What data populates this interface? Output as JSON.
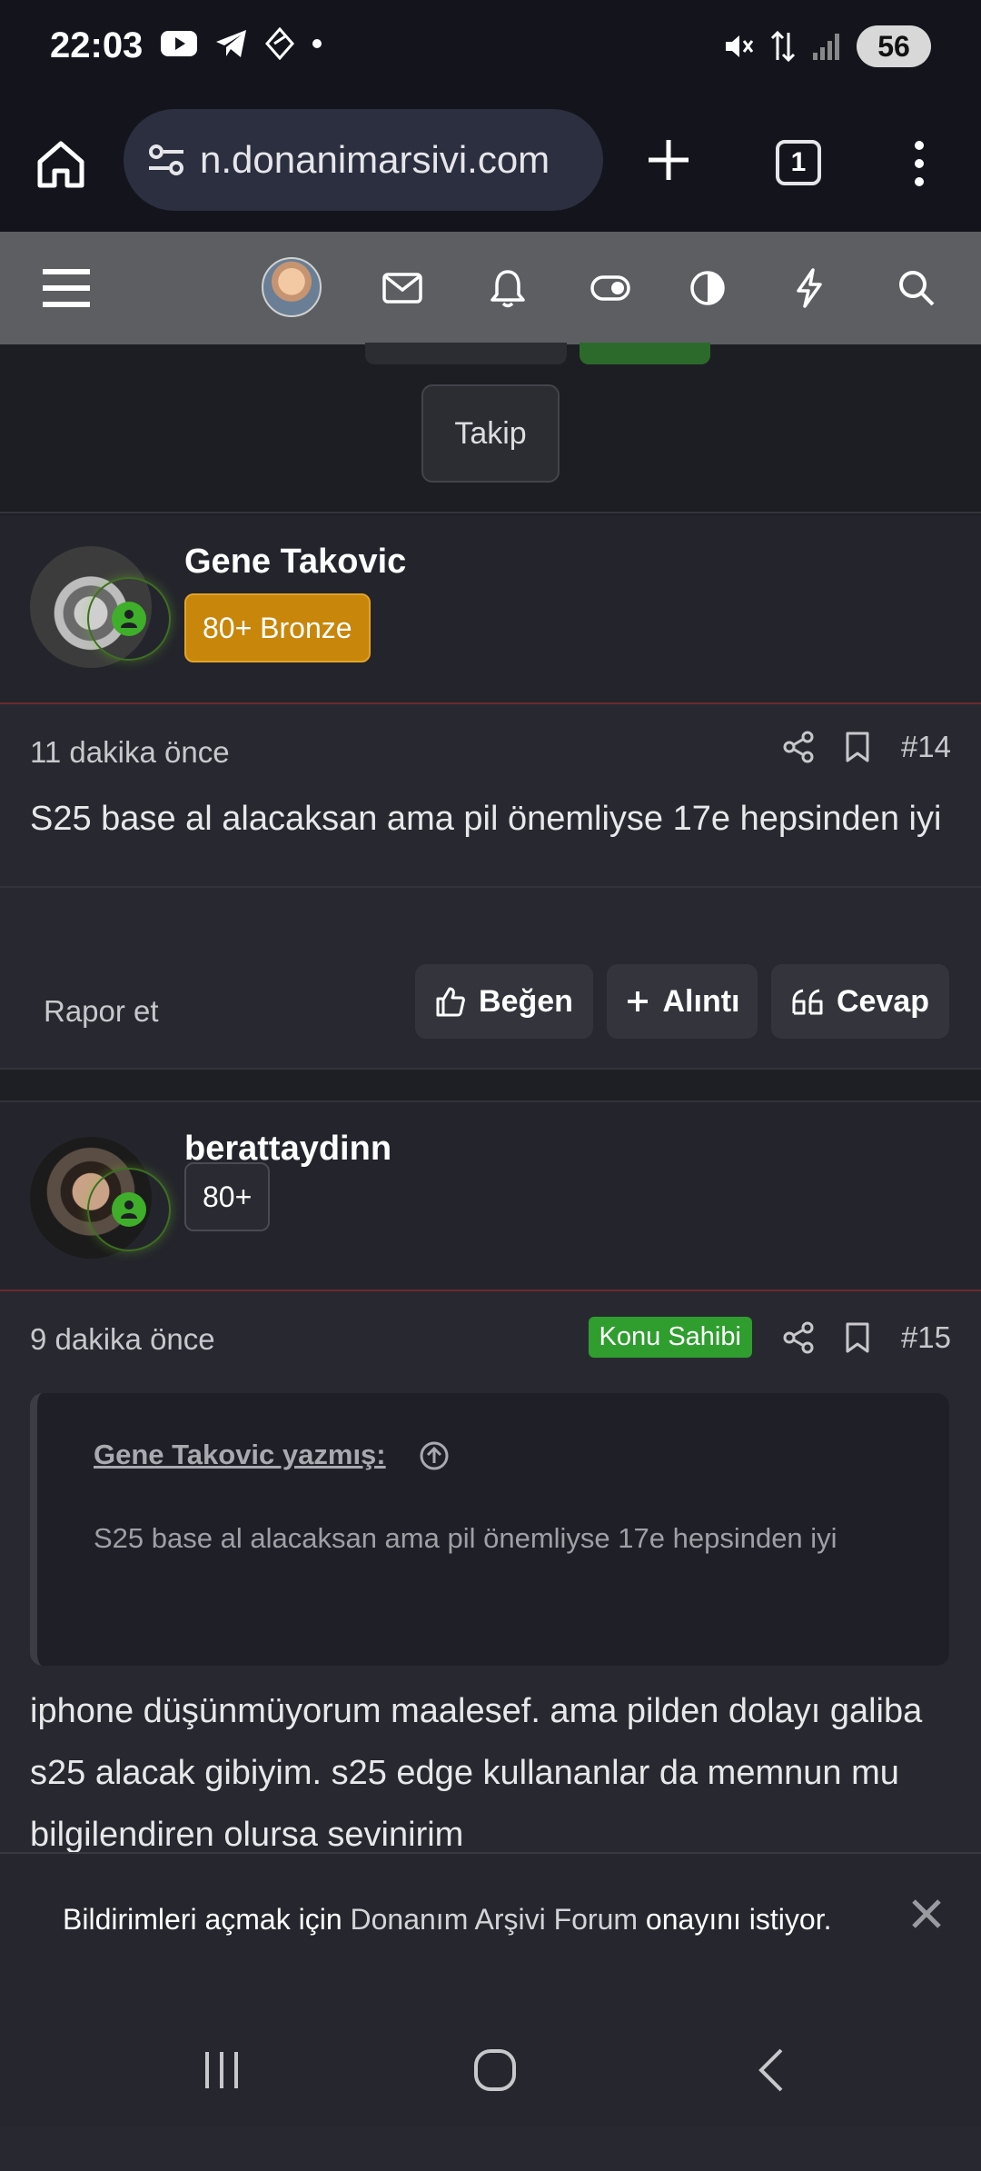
{
  "status_bar": {
    "time": "22:03",
    "battery": "56",
    "icons": [
      "youtube-icon",
      "telegram-icon",
      "diamond-icon",
      "dot-icon",
      "mute-icon",
      "data-icon",
      "signal-icon"
    ]
  },
  "browser": {
    "url": "n.donanimarsivi.com",
    "tab_count": "1"
  },
  "forum_header": {
    "icons": [
      "menu-icon",
      "avatar",
      "mail-icon",
      "bell-icon",
      "toggle-icon",
      "contrast-icon",
      "flash-icon",
      "search-icon"
    ]
  },
  "top_area": {
    "follow_label": "Takip"
  },
  "posts": [
    {
      "username": "Gene Takovic",
      "badge": "80+ Bronze",
      "time_ago": "11 dakika önce",
      "number": "#14",
      "text": "S25 base al alacaksan ama pil önemliyse 17e hepsinden iyi",
      "report_label": "Rapor et",
      "like_label": "Beğen",
      "quote_label": "Alıntı",
      "reply_label": "Cevap"
    },
    {
      "username": "berattaydinn",
      "badge": "80+",
      "time_ago": "9 dakika önce",
      "owner_badge": "Konu Sahibi",
      "number": "#15",
      "quote_author": "Gene Takovic yazmış:",
      "quote_text": "S25 base al alacaksan ama pil önemliyse 17e hepsinden iyi",
      "text": "iphone düşünmüyorum maalesef. ama pilden dolayı galiba s25 alacak gibiyim. s25 edge kullananlar da memnun mu bilgilendiren olursa sevinirim"
    }
  ],
  "notification": {
    "prefix": "Bildirimleri açmak için",
    "host": "Donanım Arşivi Forum",
    "suffix": "onayını istiyor."
  }
}
